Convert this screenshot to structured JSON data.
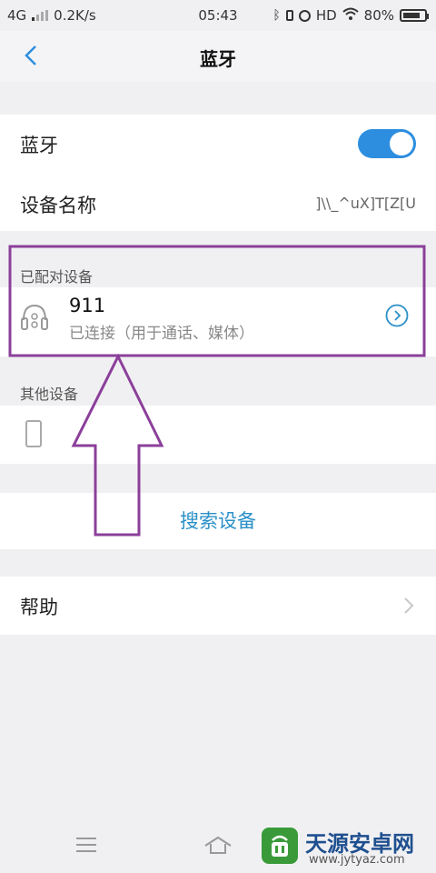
{
  "status_bar": {
    "network": "4G",
    "speed": "0.2K/s",
    "time": "05:43",
    "hd": "HD",
    "battery": "80%",
    "battery_level": 0.8
  },
  "header": {
    "title": "蓝牙"
  },
  "bluetooth_toggle": {
    "label": "蓝牙",
    "enabled": true
  },
  "device_name": {
    "label": "设备名称",
    "value": "]\\\\_^uX]T[Z[U"
  },
  "paired_section": {
    "label": "已配对设备",
    "devices": [
      {
        "name": "911",
        "status": "已连接（用于通话、媒体）"
      }
    ]
  },
  "other_section": {
    "label": "其他设备"
  },
  "search_button": {
    "label": "搜索设备"
  },
  "help": {
    "label": "帮助"
  },
  "watermark": {
    "title": "天源安卓网",
    "url": "www.jytyaz.com"
  },
  "colors": {
    "accent": "#2d8ee0",
    "annotation": "#8b3f9a",
    "link": "#2b90c8"
  }
}
